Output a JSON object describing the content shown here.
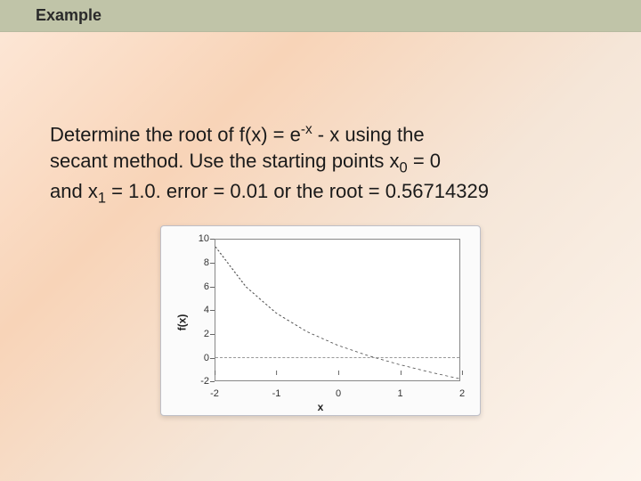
{
  "title": "Example",
  "problem": {
    "line1a": "Determine the root of  f(x) = e",
    "sup1": "-x",
    "line1b": " - x using the",
    "line2a": "secant method.  Use the starting points x",
    "sub0": "0",
    "line2b": " = 0",
    "line3a": "and x",
    "sub1": "1",
    "line3b": " = 1.0. error = 0.01 or the root = 0.56714329"
  },
  "chart_data": {
    "type": "line",
    "xlabel": "x",
    "ylabel": "f(x)",
    "xticks": [
      -2,
      -1,
      0,
      1,
      2
    ],
    "yticks": [
      -2,
      0,
      2,
      4,
      6,
      8,
      10
    ],
    "xlim": [
      -2,
      2
    ],
    "ylim": [
      -2,
      10
    ],
    "series": [
      {
        "name": "f(x) = e^{-x} - x",
        "x": [
          -2,
          -1.5,
          -1,
          -0.5,
          0,
          0.5,
          1,
          1.5,
          2
        ],
        "y": [
          9.39,
          5.98,
          3.72,
          2.15,
          1.0,
          0.11,
          -0.63,
          -1.28,
          -1.86
        ]
      }
    ]
  }
}
